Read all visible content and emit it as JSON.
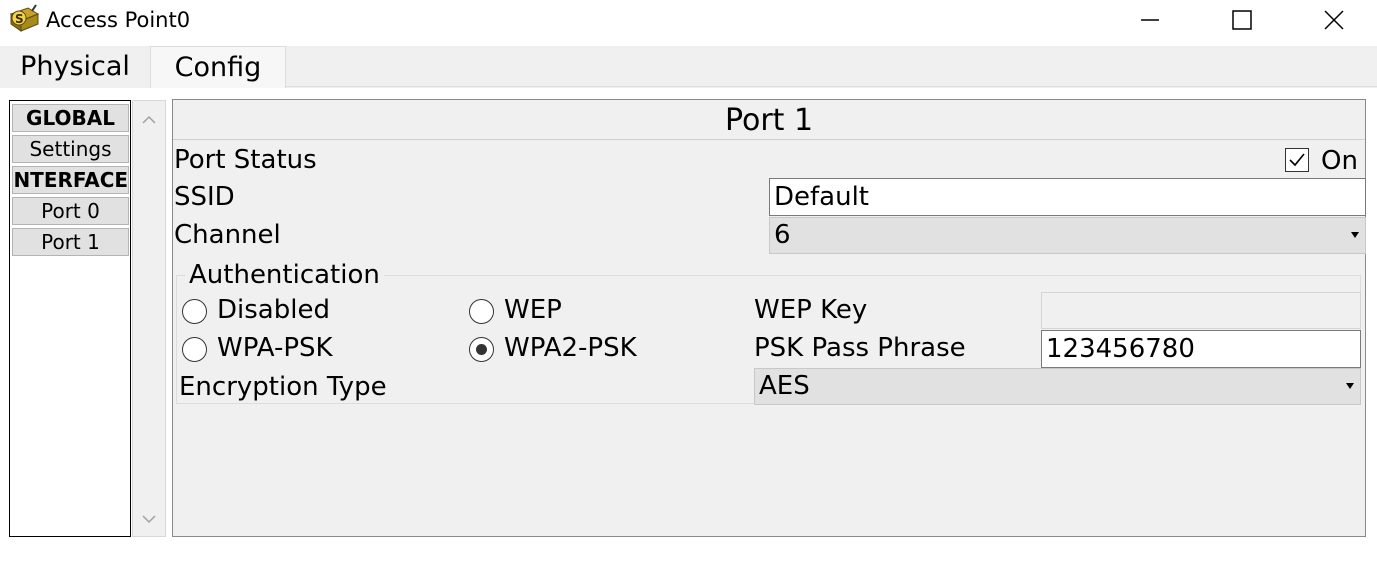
{
  "window": {
    "title": "Access Point0",
    "icon": "access-point-app-icon",
    "controls": [
      "minimize-icon",
      "maximize-icon",
      "close-icon"
    ]
  },
  "tabs": [
    {
      "label": "Physical",
      "active": false
    },
    {
      "label": "Config",
      "active": true
    }
  ],
  "sidebar": {
    "items": [
      {
        "label": "GLOBAL",
        "type": "header"
      },
      {
        "label": "Settings",
        "type": "item"
      },
      {
        "label": "INTERFACE",
        "type": "header"
      },
      {
        "label": "Port 0",
        "type": "item"
      },
      {
        "label": "Port 1",
        "type": "item"
      }
    ]
  },
  "panel": {
    "title": "Port 1",
    "port_status_label": "Port Status",
    "port_status_checkbox_label": "On",
    "port_status_checked": true,
    "ssid_label": "SSID",
    "ssid_value": "Default",
    "channel_label": "Channel",
    "channel_value": "6",
    "auth": {
      "legend": "Authentication",
      "options": [
        "Disabled",
        "WEP",
        "WPA-PSK",
        "WPA2-PSK"
      ],
      "selected": "WPA2-PSK",
      "wep_key_label": "WEP Key",
      "wep_key_value": "",
      "psk_label": "PSK Pass Phrase",
      "psk_value": "123456780",
      "encryption_label": "Encryption Type",
      "encryption_value": "AES"
    }
  }
}
